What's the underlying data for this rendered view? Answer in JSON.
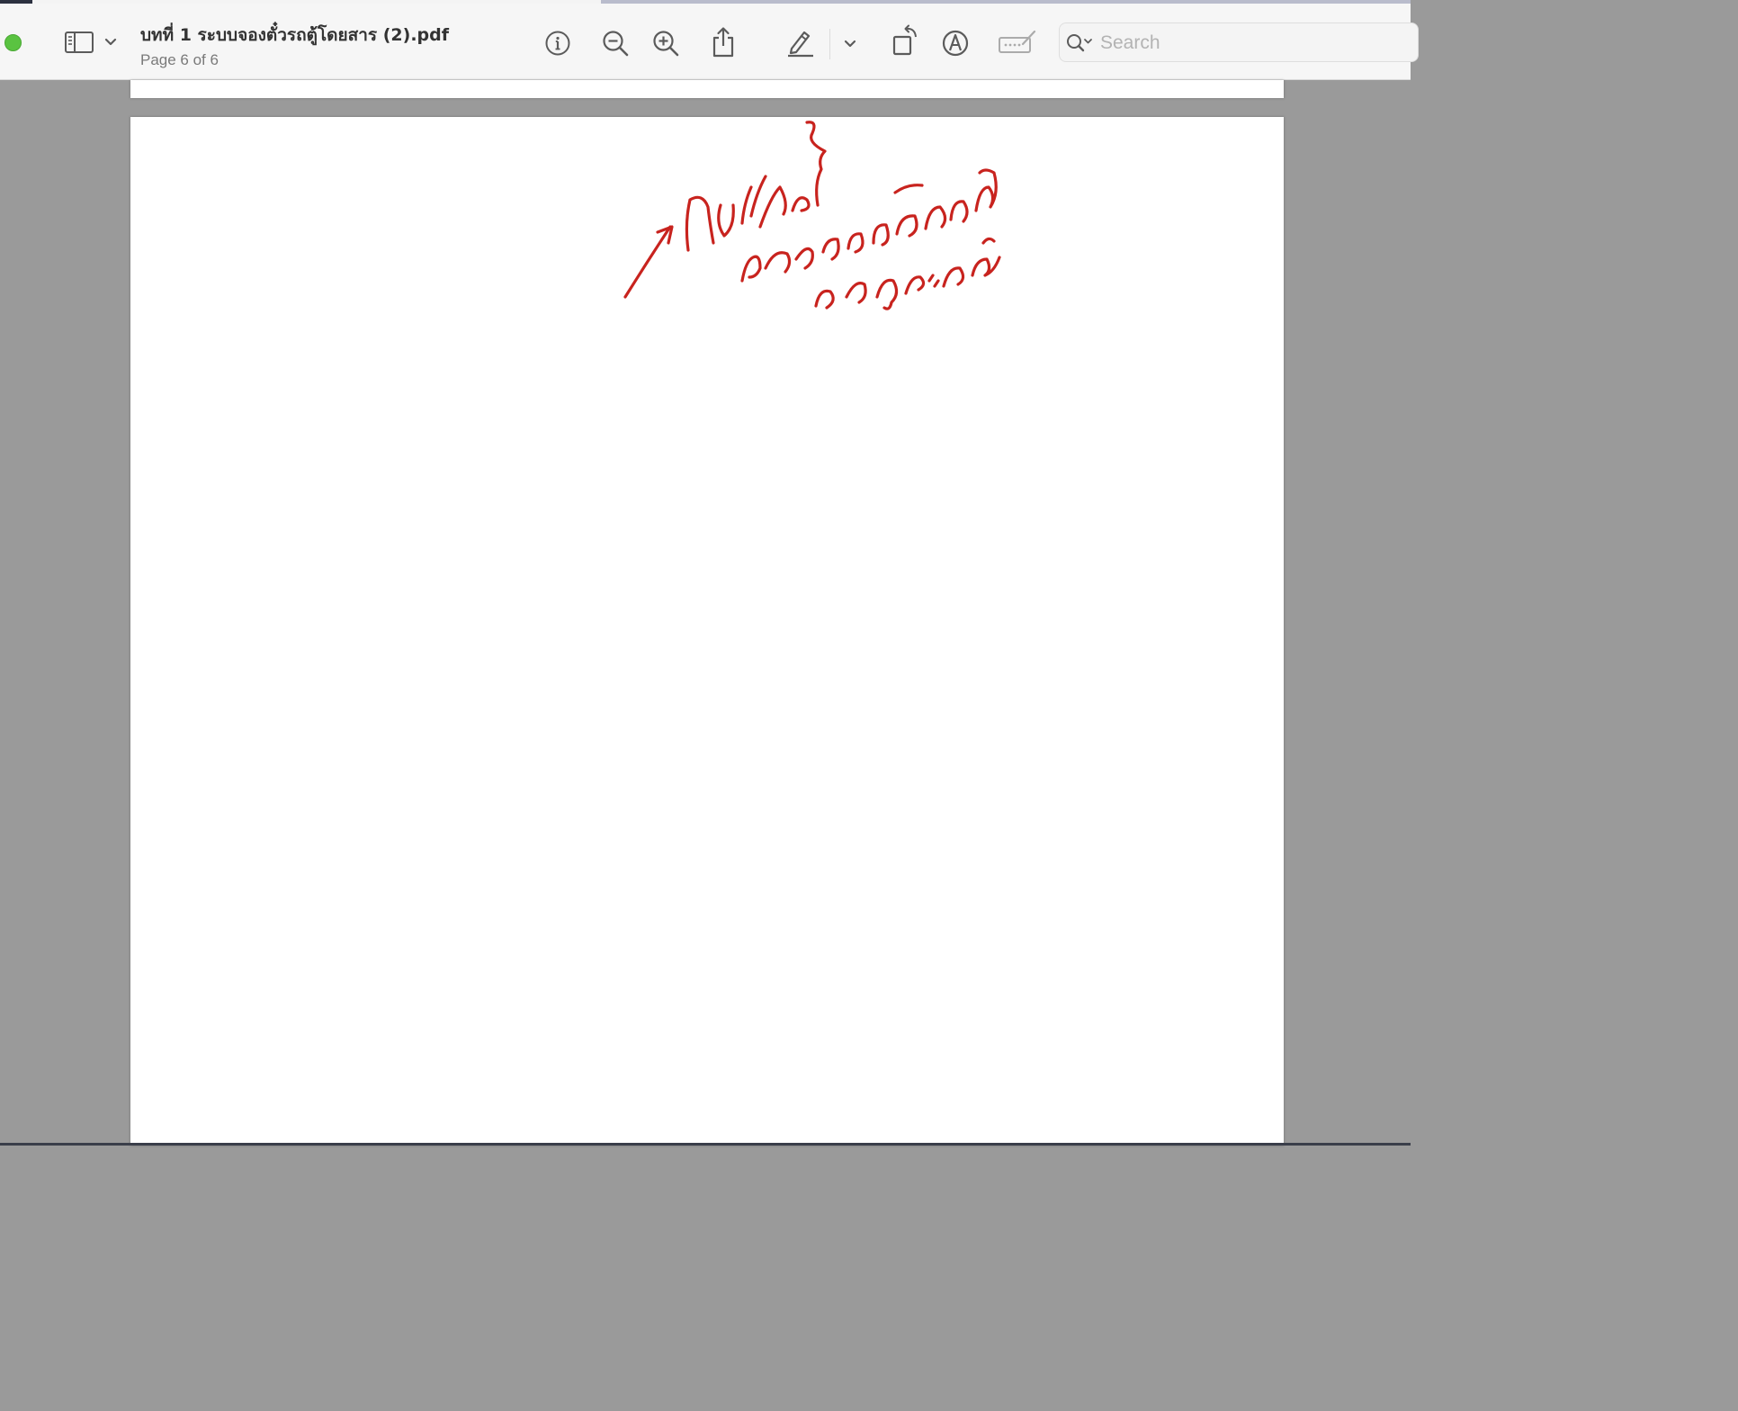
{
  "window": {
    "title": "บทที่ 1 ระบบจองตั๋วรถตู้โดยสาร (2).pdf",
    "subtitle": "Page 6 of 6"
  },
  "toolbar": {
    "icons": [
      "sidebar-icon",
      "chevron-down-icon",
      "info-icon",
      "zoom-out-icon",
      "zoom-in-icon",
      "share-icon",
      "highlight-pen-icon",
      "chevron-down-icon",
      "rotate-icon",
      "markup-icon",
      "form-fill-icon",
      "search-icon"
    ]
  },
  "search": {
    "placeholder": "Search",
    "value": ""
  },
  "document": {
    "current_page": 6,
    "total_pages": 6,
    "annotation": {
      "ink_color": "#c8231e",
      "handwritten_lines": [
        "ปกไฟฟรป",
        "ตัวอักษรสีดคลัดกับ",
        "จังควประลงค์"
      ]
    }
  },
  "colors": {
    "window_close_green": "#5ac341",
    "toolbar_bg": "#f6f6f6",
    "canvas_bg": "#9a9a9a",
    "page_bg": "#ffffff"
  }
}
